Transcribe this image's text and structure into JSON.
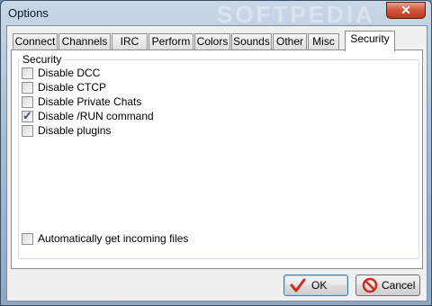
{
  "window": {
    "title": "Options",
    "watermark": "SOFTPEDIA",
    "close_glyph": "✕"
  },
  "tabs": [
    {
      "label": "Connect",
      "active": false
    },
    {
      "label": "Channels",
      "active": false
    },
    {
      "label": "IRC",
      "active": false
    },
    {
      "label": "Perform",
      "active": false
    },
    {
      "label": "Colors",
      "active": false
    },
    {
      "label": "Sounds",
      "active": false
    },
    {
      "label": "Other",
      "active": false
    },
    {
      "label": "Misc",
      "active": false
    },
    {
      "label": "Security",
      "active": true
    }
  ],
  "security": {
    "group_label": "Security",
    "options": [
      {
        "label": "Disable DCC",
        "checked": false
      },
      {
        "label": "Disable CTCP",
        "checked": false
      },
      {
        "label": "Disable Private Chats",
        "checked": false
      },
      {
        "label": "Disable /RUN command",
        "checked": true
      },
      {
        "label": "Disable plugins",
        "checked": false
      }
    ],
    "auto_incoming": {
      "label": "Automatically get incoming files",
      "checked": false
    }
  },
  "buttons": {
    "ok": "OK",
    "cancel": "Cancel"
  },
  "colors": {
    "ok_icon": "#d02a1e",
    "cancel_icon": "#d02a1e"
  },
  "icons": {
    "ok": "checkmark-icon",
    "cancel": "no-entry-icon"
  }
}
